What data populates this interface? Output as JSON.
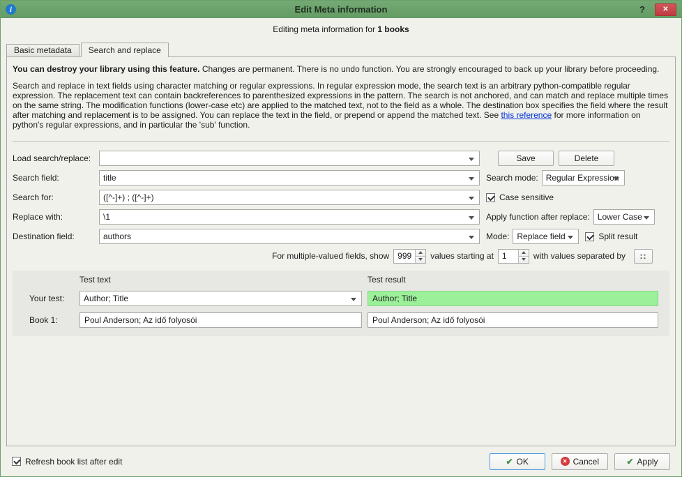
{
  "titlebar": {
    "title": "Edit Meta information",
    "help": "?",
    "close": "✕"
  },
  "header": {
    "prefix": "Editing meta information for ",
    "count": "1 books"
  },
  "tabs": {
    "basic": "Basic metadata",
    "search": "Search and replace"
  },
  "intro": {
    "warning_bold": "You can destroy your library using this feature.",
    "warning_rest": " Changes are permanent. There is no undo function. You are strongly encouraged to back up your library before proceeding.",
    "desc_before_link": "Search and replace in text fields using character matching or regular expressions. In regular expression mode, the search text is an arbitrary python-compatible regular expression. The replacement text can contain backreferences to parenthesized expressions in the pattern. The search is not anchored, and can match and replace multiple times on the same string. The modification functions (lower-case etc) are applied to the matched text, not to the field as a whole. The destination box specifies the field where the result after matching and replacement is to be assigned. You can replace the text in the field, or prepend or append the matched text. See ",
    "link": "this reference",
    "desc_after_link": " for more information on python's regular expressions, and in particular the 'sub' function."
  },
  "form": {
    "load_label": "Load search/replace:",
    "load_value": "",
    "save": "Save",
    "delete": "Delete",
    "search_field_label": "Search field:",
    "search_field": "title",
    "search_mode_label": "Search mode:",
    "search_mode": "Regular Expression",
    "search_for_label": "Search for:",
    "search_for": "([^-]+) ; ([^-]+)",
    "case_sensitive": "Case sensitive",
    "replace_with_label": "Replace with:",
    "replace_with": "\\1",
    "apply_func_label": "Apply function after replace:",
    "apply_func": "Lower Case",
    "dest_label": "Destination field:",
    "dest": "authors",
    "mode_label": "Mode:",
    "mode": "Replace field",
    "split_result": "Split result",
    "multi_show_label": "For multiple-valued fields, show",
    "multi_show": "999",
    "multi_start_label": "values starting at",
    "multi_start": "1",
    "multi_sep_label": "with values separated by",
    "multi_sep_button": "::"
  },
  "test": {
    "col_text": "Test text",
    "col_result": "Test result",
    "your_test_label": "Your test:",
    "your_test_value": "Author; Title",
    "your_test_result": "Author; Title",
    "book1_label": "Book 1:",
    "book1_value": "Poul Anderson; Az idő folyosói",
    "book1_result": "Poul Anderson; Az idő folyosói"
  },
  "footer": {
    "refresh": "Refresh book list after edit",
    "ok": "OK",
    "cancel": "Cancel",
    "apply": "Apply"
  },
  "colors": {
    "titlebar_green": "#6ba36b",
    "close_red": "#c9474c",
    "match_green": "#9df09a",
    "link_blue": "#0433d8"
  }
}
